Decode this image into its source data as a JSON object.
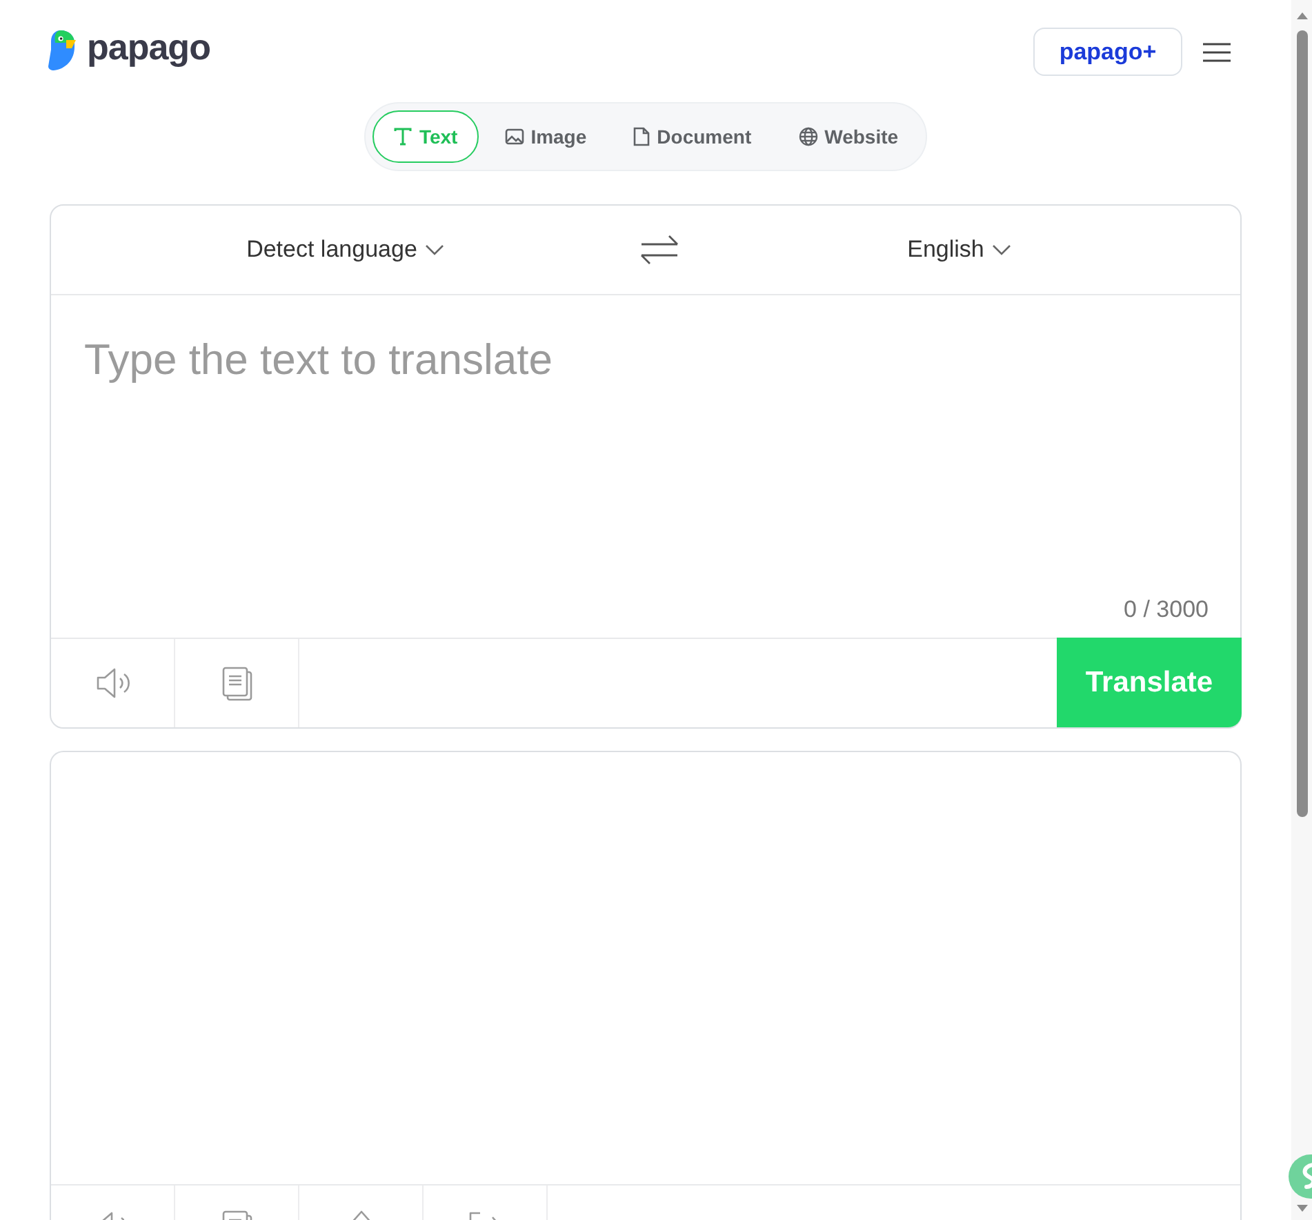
{
  "header": {
    "logo_text": "papago",
    "plus_button": "papago+"
  },
  "mode_tabs": [
    {
      "label": "Text",
      "kind": "text",
      "selected": true
    },
    {
      "label": "Image",
      "kind": "image",
      "selected": false
    },
    {
      "label": "Document",
      "kind": "document",
      "selected": false
    },
    {
      "label": "Website",
      "kind": "website",
      "selected": false
    }
  ],
  "source_panel": {
    "source_language": "Detect language",
    "target_language": "English",
    "placeholder": "Type the text to translate",
    "char_count": "0 / 3000",
    "tools": [
      {
        "kind": "speaker"
      },
      {
        "kind": "copy"
      }
    ],
    "translate_button": "Translate"
  },
  "result_panel": {
    "tools": [
      {
        "kind": "speaker"
      },
      {
        "kind": "copy"
      },
      {
        "kind": "share"
      },
      {
        "kind": "expand"
      }
    ]
  }
}
